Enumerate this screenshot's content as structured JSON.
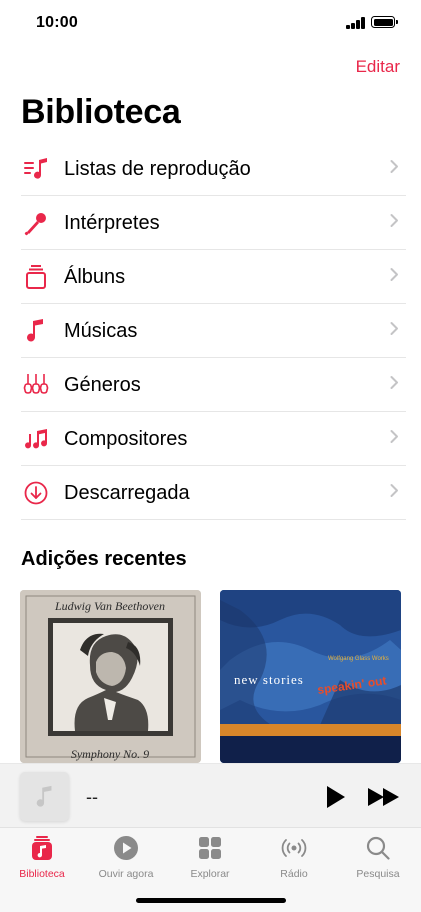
{
  "status_bar": {
    "time": "10:00"
  },
  "header": {
    "edit_label": "Editar",
    "title": "Biblioteca"
  },
  "menu": {
    "items": [
      {
        "label": "Listas de reprodução",
        "icon": "playlist-icon"
      },
      {
        "label": "Intérpretes",
        "icon": "microphone-icon"
      },
      {
        "label": "Álbuns",
        "icon": "album-stack-icon"
      },
      {
        "label": "Músicas",
        "icon": "music-note-icon"
      },
      {
        "label": "Géneros",
        "icon": "guitars-icon"
      },
      {
        "label": "Compositores",
        "icon": "music-notes-icon"
      },
      {
        "label": "Descarregada",
        "icon": "download-circle-icon"
      }
    ]
  },
  "recent": {
    "title": "Adições recentes",
    "albums": [
      {
        "cover_text_top": "Ludwig Van Beethoven",
        "cover_text_bottom": "Symphony No. 9"
      },
      {
        "cover_text_small": "Wolfgang Glass Works",
        "cover_text_main": "new stories",
        "cover_text_accent": "speakin' out"
      }
    ]
  },
  "mini_player": {
    "title": "--"
  },
  "tabs": [
    {
      "label": "Biblioteca",
      "icon": "library-icon",
      "active": true
    },
    {
      "label": "Ouvir agora",
      "icon": "play-circle-icon",
      "active": false
    },
    {
      "label": "Explorar",
      "icon": "browse-grid-icon",
      "active": false
    },
    {
      "label": "Rádio",
      "icon": "radio-waves-icon",
      "active": false
    },
    {
      "label": "Pesquisa",
      "icon": "search-icon",
      "active": false
    }
  ],
  "colors": {
    "accent": "#e9274a",
    "inactive": "#8a8a8a"
  }
}
